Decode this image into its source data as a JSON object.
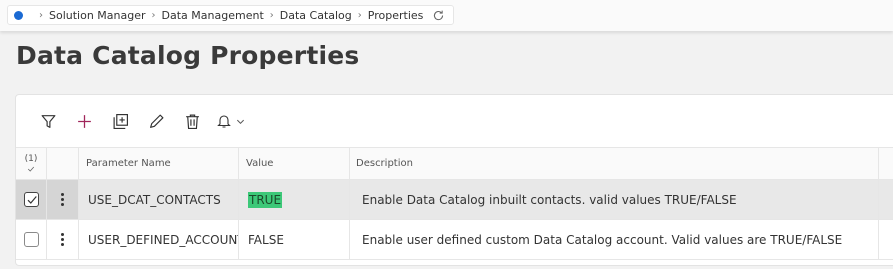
{
  "breadcrumb": {
    "items": [
      "Solution Manager",
      "Data Management",
      "Data Catalog",
      "Properties"
    ]
  },
  "page": {
    "title": "Data Catalog Properties"
  },
  "toolbar": {
    "buttons": [
      "filter-icon",
      "add-icon",
      "duplicate-icon",
      "edit-icon",
      "delete-icon",
      "bell-icon"
    ]
  },
  "table": {
    "selection_count": "(1)",
    "columns": [
      "Parameter Name",
      "Value",
      "Description"
    ],
    "rows": [
      {
        "selected": true,
        "name": "USE_DCAT_CONTACTS",
        "value": "TRUE",
        "description": "Enable Data Catalog inbuilt contacts. valid values TRUE/FALSE"
      },
      {
        "selected": false,
        "name": "USER_DEFINED_ACCOUNT",
        "value": "FALSE",
        "description": "Enable user defined custom Data Catalog account. Valid values are TRUE/FALSE"
      }
    ]
  },
  "colors": {
    "accent": "#1b6ad3",
    "highlight": "#3cc878"
  }
}
